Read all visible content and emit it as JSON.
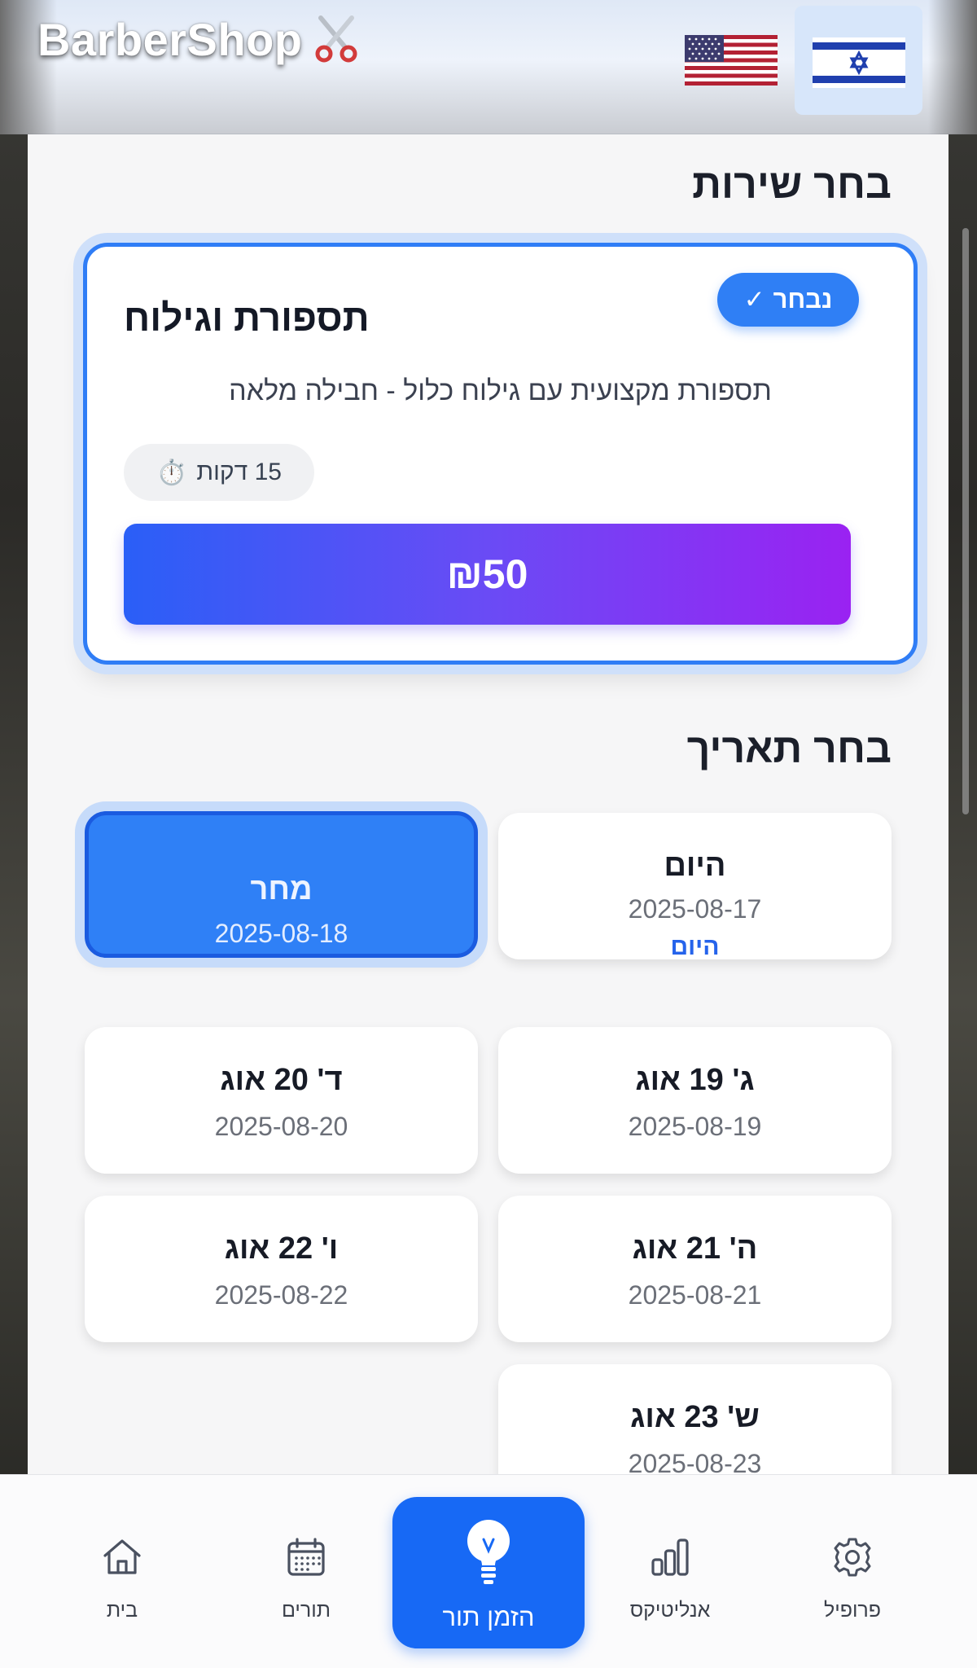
{
  "header": {
    "brand": "BarberShop",
    "brand_icon": "scissors-icon",
    "languages": [
      {
        "name": "us-flag-icon",
        "selected": false
      },
      {
        "name": "israel-flag-icon",
        "selected": true
      }
    ]
  },
  "service_section": {
    "title": "בחר שירות",
    "card": {
      "selected_label": "נבחר",
      "check_icon": "✓",
      "name": "תספורת וגילוח",
      "description": "תספורת מקצועית עם גילוח כלול - חבילה מלאה",
      "duration_icon": "⏱️",
      "duration": "15 דקות",
      "price": "₪50"
    }
  },
  "date_section": {
    "title": "בחר תאריך",
    "dates": [
      {
        "label": "היום",
        "date": "2025-08-17",
        "today_tag": "היום",
        "selected": false
      },
      {
        "label": "מחר",
        "date": "2025-08-18",
        "selected": true
      },
      {
        "label": "ג' 19 אוג",
        "date": "2025-08-19",
        "selected": false
      },
      {
        "label": "ד' 20 אוג",
        "date": "2025-08-20",
        "selected": false
      },
      {
        "label": "ה' 21 אוג",
        "date": "2025-08-21",
        "selected": false
      },
      {
        "label": "ו' 22 אוג",
        "date": "2025-08-22",
        "selected": false
      },
      {
        "label": "ש' 23 אוג",
        "date": "2025-08-23",
        "selected": false
      }
    ]
  },
  "bottom_nav": {
    "items": [
      {
        "label": "בית",
        "icon": "home-icon"
      },
      {
        "label": "תורים",
        "icon": "calendar-icon"
      },
      {
        "label": "הזמן תור",
        "icon": "lightbulb-icon",
        "active": true
      },
      {
        "label": "אנליטיקס",
        "icon": "bar-chart-icon"
      },
      {
        "label": "פרופיל",
        "icon": "gear-icon"
      }
    ]
  },
  "colors": {
    "accent": "#2f7ff5",
    "price_gradient_start": "#2a5ff7",
    "price_gradient_end": "#9a22f2",
    "nav_active": "#1769f5"
  }
}
